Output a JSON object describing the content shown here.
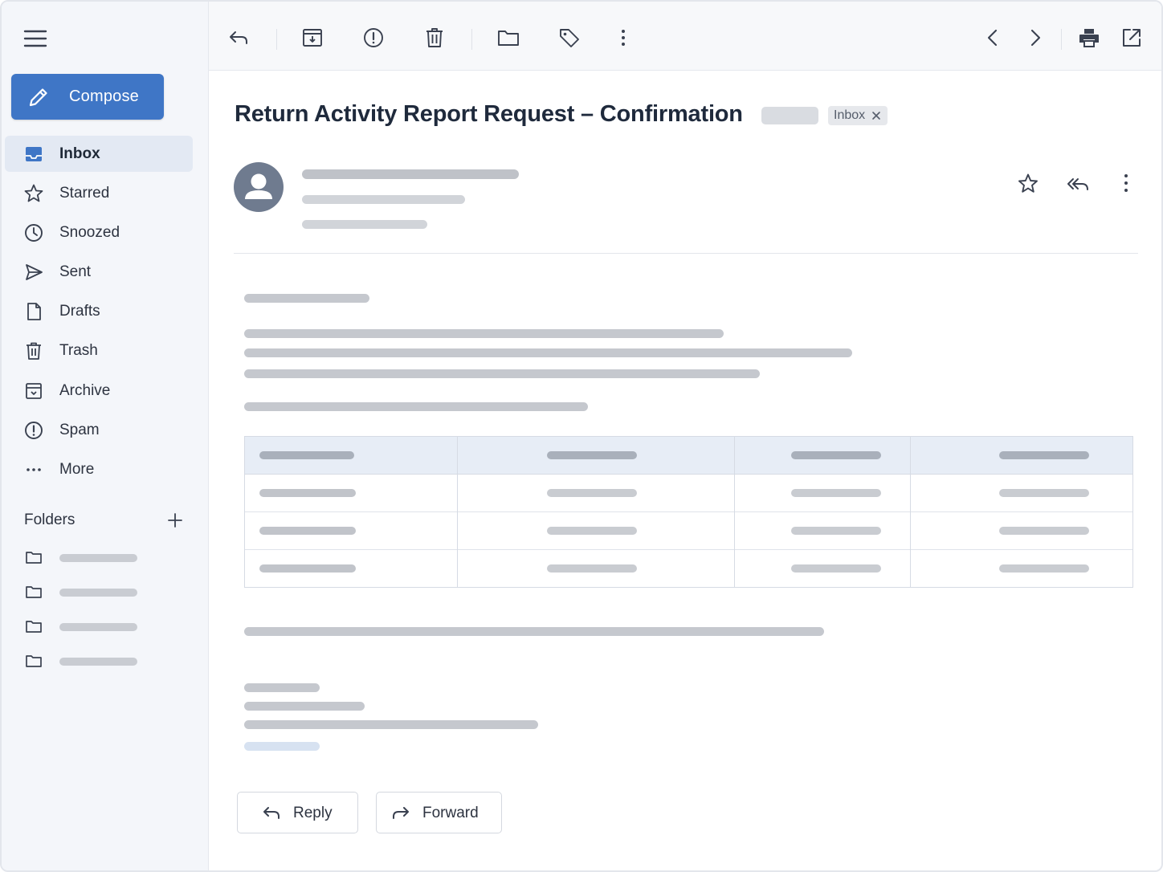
{
  "sidebar": {
    "compose_label": "Compose",
    "items": [
      {
        "label": "Inbox",
        "icon": "inbox-icon",
        "active": true
      },
      {
        "label": "Starred",
        "icon": "star-icon"
      },
      {
        "label": "Snoozed",
        "icon": "clock-icon"
      },
      {
        "label": "Sent",
        "icon": "send-icon"
      },
      {
        "label": "Drafts",
        "icon": "draft-icon"
      },
      {
        "label": "Trash",
        "icon": "trash-icon"
      },
      {
        "label": "Archive",
        "icon": "archive-icon"
      },
      {
        "label": "Spam",
        "icon": "spam-icon"
      },
      {
        "label": "More",
        "icon": "more-horizontal-icon"
      }
    ],
    "folders_heading": "Folders"
  },
  "toolbar": {
    "icons": [
      "back-icon",
      "archive-icon",
      "spam-icon",
      "trash-icon",
      "move-to-folder-icon",
      "label-icon",
      "more-vertical-icon",
      "previous-icon",
      "next-icon",
      "print-icon",
      "open-in-new-window-icon"
    ]
  },
  "message": {
    "subject": "Return Activity Report Request – Confirmation",
    "label": "Inbox",
    "actions": [
      "star-icon",
      "reply-all-icon",
      "more-vertical-icon"
    ]
  },
  "footer": {
    "reply_label": "Reply",
    "forward_label": "Forward"
  },
  "colors": {
    "accent": "#3f76c6",
    "sidebar_bg": "#f4f6fa",
    "active_item_bg": "#e3e9f3",
    "table_header_bg": "#e7edf6",
    "skeleton": "#c5c8ce"
  }
}
